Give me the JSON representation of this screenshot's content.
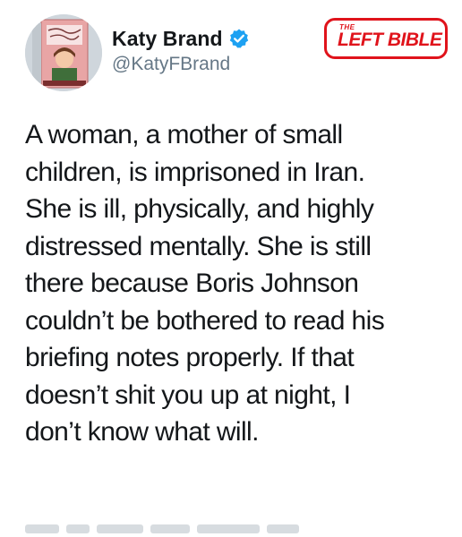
{
  "header": {
    "display_name": "Katy Brand",
    "handle": "@KatyFBrand",
    "verified": true
  },
  "avatar": {
    "book_cover_title": "I Carried a Watermelon",
    "book_cover_author": "KATY BRAND"
  },
  "watermark": {
    "prefix": "THE",
    "name": "LEFT BIBLE",
    "color": "#e0131b"
  },
  "tweet": {
    "lines": [
      "A woman, a mother of small",
      "children, is imprisoned in Iran.",
      "She is ill, physically, and highly",
      "distressed mentally.  She is still",
      "there because Boris Johnson",
      "couldn’t be bothered to read his",
      "briefing notes properly.  If that",
      "doesn’t shit you up at night, I",
      "don’t know what will."
    ]
  },
  "colors": {
    "text": "#14171a",
    "secondary": "#657786",
    "verified": "#1da1f2",
    "background": "#ffffff"
  }
}
